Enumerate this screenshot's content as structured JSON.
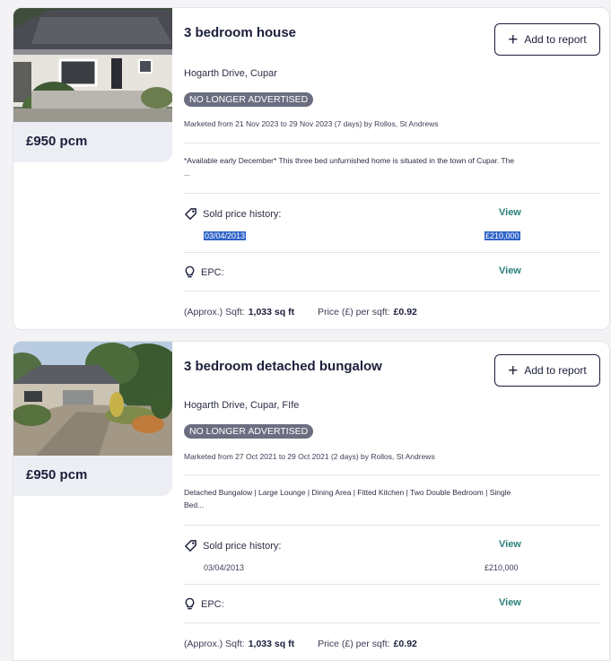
{
  "listings": [
    {
      "price": "£950 pcm",
      "title": "3 bedroom house",
      "add_button": "Add to report",
      "address": "Hogarth Drive, Cupar",
      "badge": "NO LONGER ADVERTISED",
      "marketed": "Marketed from 21 Nov 2023 to 29 Nov 2023 (7 days) by Rollos, St Andrews",
      "description_line1": "*Available early December* This three bed unfurnished home is situated in the town of Cupar. The",
      "description_line2": "...",
      "sold_label": "Sold price history:",
      "sold_view": "View",
      "sold_date": "03/04/2013",
      "sold_price": "£210,000",
      "epc_label": "EPC:",
      "epc_view": "View",
      "sqft_label": "(Approx.) Sqft:",
      "sqft_value": "1,033 sq ft",
      "ppsf_label": "Price (£) per sqft:",
      "ppsf_value": "£0.92"
    },
    {
      "price": "£950 pcm",
      "title": "3 bedroom detached bungalow",
      "add_button": "Add to report",
      "address": "Hogarth Drive, Cupar, FIfe",
      "badge": "NO LONGER ADVERTISED",
      "marketed": "Marketed from 27 Oct 2021 to 29 Oct 2021 (2 days) by Rollos, St Andrews",
      "description_line1": "Detached Bungalow | Large Lounge | Dining Area | Fitted Kitchen | Two Double Bedroom | Single",
      "description_line2": "Bed...",
      "sold_label": "Sold price history:",
      "sold_view": "View",
      "sold_date": "03/04/2013",
      "sold_price": "£210,000",
      "epc_label": "EPC:",
      "epc_view": "View",
      "sqft_label": "(Approx.) Sqft:",
      "sqft_value": "1,033 sq ft",
      "ppsf_label": "Price (£) per sqft:",
      "ppsf_value": "£0.92"
    }
  ],
  "icons": {
    "plus": "plus-icon",
    "tag": "tag-icon",
    "bulb": "lightbulb-icon"
  },
  "colors": {
    "text": "#1b1f3b",
    "link": "#2a7f7a",
    "badge": "#6b6e80",
    "selection": "#2f63c7"
  }
}
